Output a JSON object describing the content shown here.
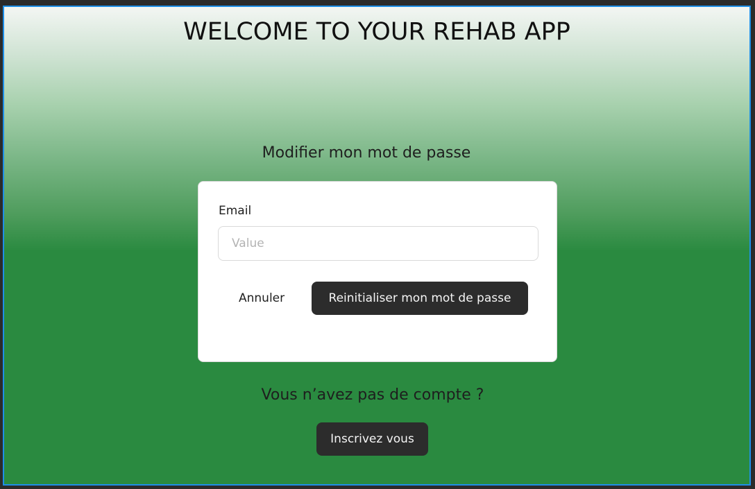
{
  "colors": {
    "frame_border": "#1e8fe8",
    "background_top": "#f3f6f3",
    "background_bottom": "#2a8a40",
    "dark_button": "#2c2c2c",
    "card_background": "#ffffff"
  },
  "header": {
    "title": "WELCOME TO YOUR REHAB APP"
  },
  "reset_form": {
    "heading": "Modifier mon mot de passe",
    "email_label": "Email",
    "email_value": "",
    "email_placeholder": "Value",
    "cancel_label": "Annuler",
    "reset_label": "Reinitialiser mon mot de passe"
  },
  "signup": {
    "prompt": "Vous n’avez pas de compte ?",
    "button_label": "Inscrivez vous"
  }
}
